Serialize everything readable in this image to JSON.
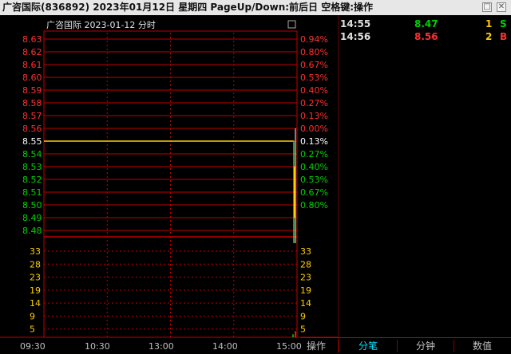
{
  "window": {
    "title": "广咨国际(836892)  2023年01月12日 星期四 PageUp/Down:前后日 空格键:操作",
    "restore_icon": "□",
    "close_icon": "✕"
  },
  "chart": {
    "header": "广咨国际  2023-01-12 分时",
    "price_labels": [
      "8.63",
      "8.62",
      "8.61",
      "8.60",
      "8.59",
      "8.58",
      "8.57",
      "8.56",
      "8.55",
      "8.54",
      "8.53",
      "8.52",
      "8.51",
      "8.50",
      "8.49",
      "8.48"
    ],
    "pct_labels": [
      "0.94%",
      "0.80%",
      "0.67%",
      "0.53%",
      "0.40%",
      "0.27%",
      "0.13%",
      "0.00%",
      "0.13%",
      "0.27%",
      "0.40%",
      "0.53%",
      "0.67%",
      "0.80%"
    ],
    "volume_labels": [
      "33",
      "28",
      "23",
      "19",
      "14",
      "9",
      "5"
    ],
    "time_labels": [
      "09:30",
      "10:30",
      "13:00",
      "14:00",
      "15:00"
    ],
    "ref_price": 8.55,
    "price_range": [
      8.475,
      8.635
    ],
    "colors": {
      "up": "#ff3030",
      "down": "#00d000",
      "flat": "#ffffff",
      "line": "#ffd000",
      "grid": "#c00000"
    }
  },
  "chart_data": {
    "type": "line",
    "x": [
      "09:30",
      "14:55",
      "14:56"
    ],
    "series": [
      {
        "values": [
          8.55,
          8.47,
          8.56
        ]
      }
    ],
    "volume": [
      {
        "x": "14:55",
        "value": 1
      },
      {
        "x": "14:56",
        "value": 2
      }
    ],
    "ylim": [
      8.48,
      8.63
    ],
    "volume_ylim": [
      0,
      33
    ]
  },
  "ticks": {
    "rows": [
      {
        "time": "14:55",
        "price": "8.47",
        "volume": "1",
        "side": "S"
      },
      {
        "time": "14:56",
        "price": "8.56",
        "volume": "2",
        "side": "B"
      }
    ]
  },
  "tabs": {
    "items": [
      {
        "label": "操作"
      },
      {
        "label": "分笔"
      },
      {
        "label": "分钟"
      },
      {
        "label": "数值"
      }
    ]
  }
}
